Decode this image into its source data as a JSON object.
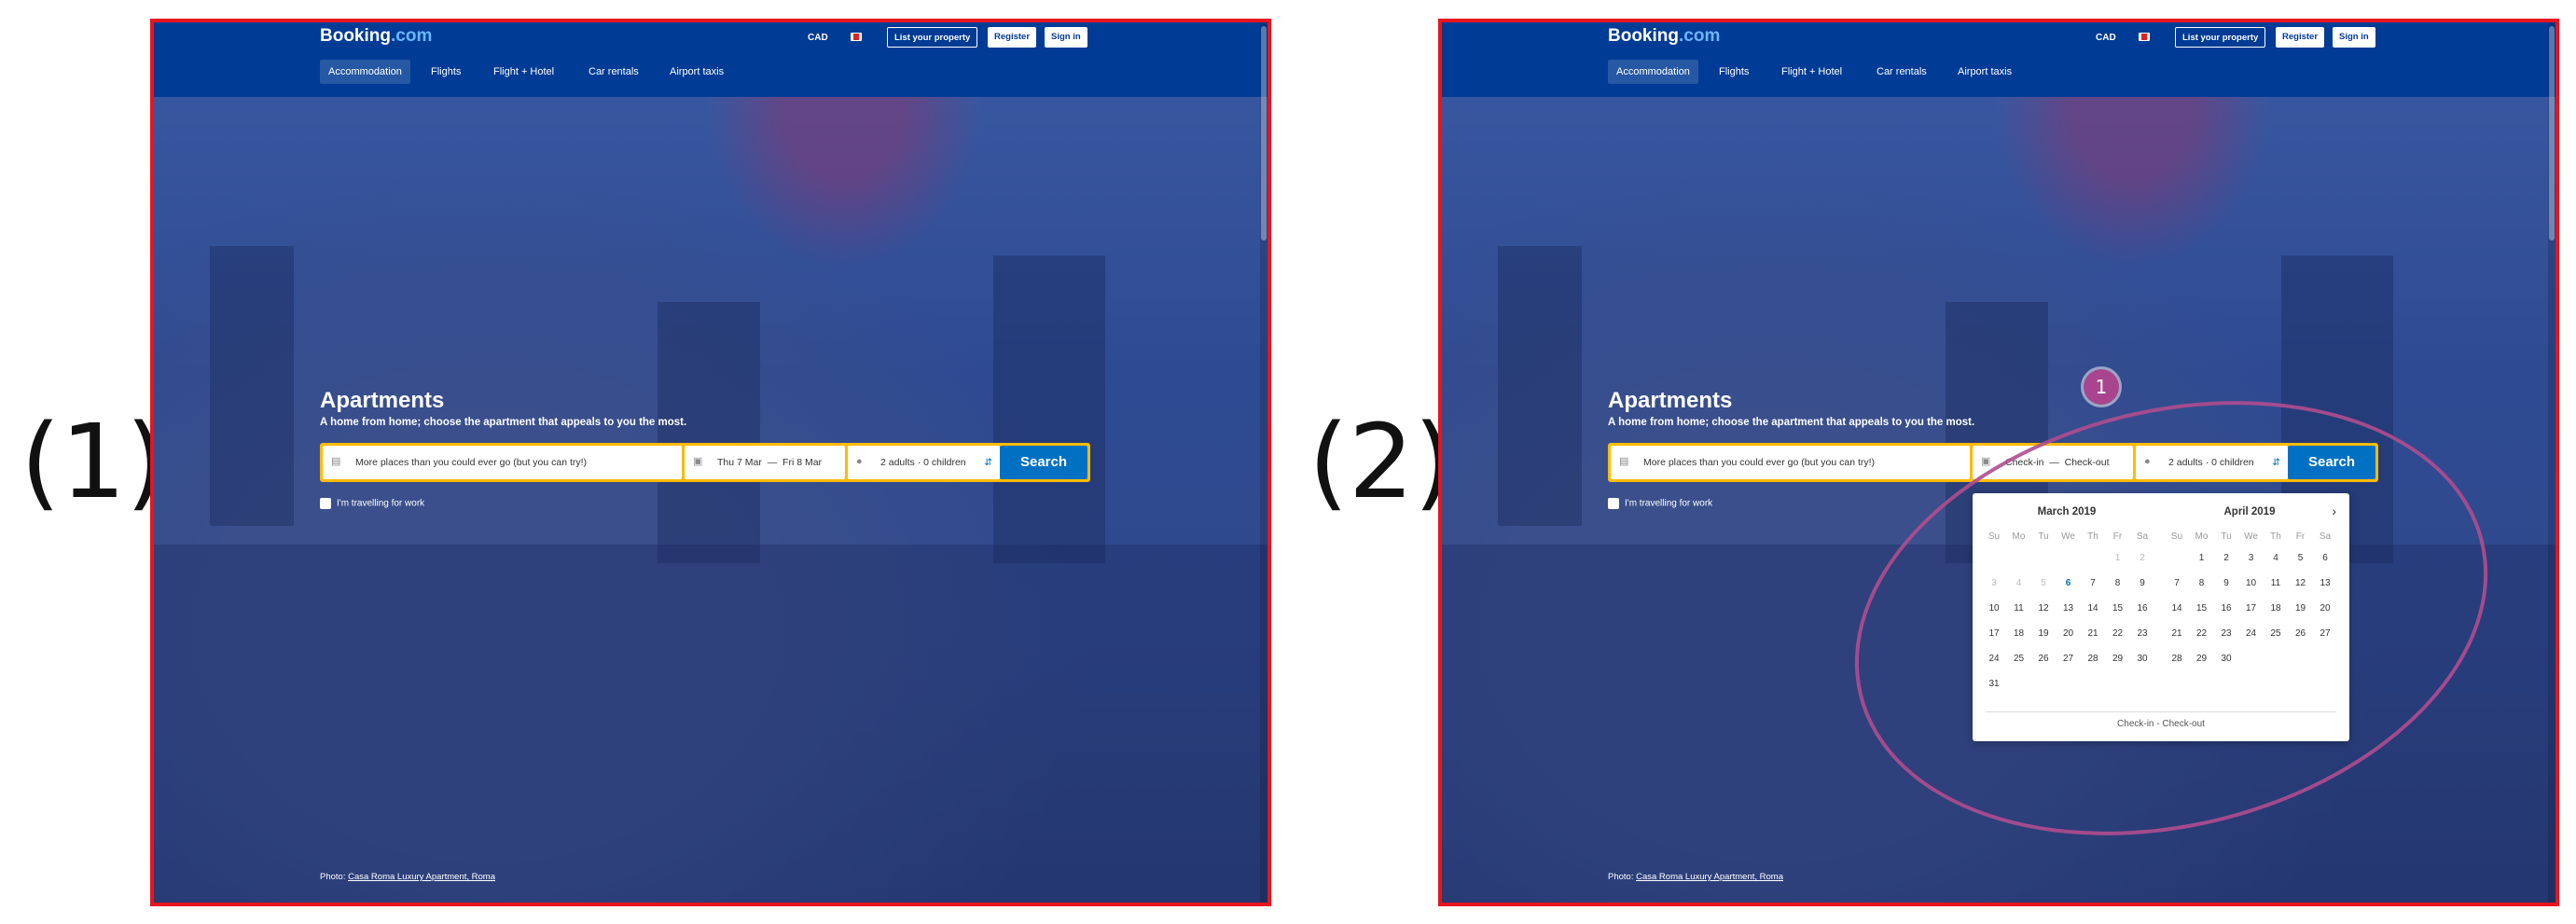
{
  "panels": [
    {
      "label": "(1)",
      "header": {
        "logo_main": "Booking",
        "logo_suffix": ".com",
        "currency": "CAD",
        "list_property": "List your property",
        "register": "Register",
        "sign_in": "Sign in"
      },
      "nav": [
        "Accommodation",
        "Flights",
        "Flight + Hotel",
        "Car rentals",
        "Airport taxis"
      ],
      "title": "Apartments",
      "subtitle": "A home from home; choose the apartment that appeals to you the most.",
      "search": {
        "destination_placeholder": "More places than you could ever go (but you can try!)",
        "checkin": "Thu 7 Mar",
        "dash": "—",
        "checkout": "Fri 8 Mar",
        "guests": "2 adults · 0 children",
        "button": "Search"
      },
      "work_label": "I'm travelling for work",
      "photo_prefix": "Photo: ",
      "photo_link": "Casa Roma Luxury Apartment, Roma"
    },
    {
      "label": "(2)",
      "header": {
        "logo_main": "Booking",
        "logo_suffix": ".com",
        "currency": "CAD",
        "list_property": "List your property",
        "register": "Register",
        "sign_in": "Sign in"
      },
      "nav": [
        "Accommodation",
        "Flights",
        "Flight + Hotel",
        "Car rentals",
        "Airport taxis"
      ],
      "title": "Apartments",
      "subtitle": "A home from home; choose the apartment that appeals to you the most.",
      "search": {
        "destination_placeholder": "More places than you could ever go (but you can try!)",
        "checkin": "Check-in",
        "dash": "—",
        "checkout": "Check-out",
        "guests": "2 adults · 0 children",
        "button": "Search"
      },
      "work_label": "I'm travelling for work",
      "photo_prefix": "Photo: ",
      "photo_link": "Casa Roma Luxury Apartment, Roma",
      "annotation_number": "1",
      "calendar": {
        "weekdays": [
          "Su",
          "Mo",
          "Tu",
          "We",
          "Th",
          "Fr",
          "Sa"
        ],
        "months": [
          {
            "title": "March 2019",
            "weeks": [
              [
                "",
                "",
                "",
                "",
                "",
                "1",
                "2"
              ],
              [
                "3",
                "4",
                "5",
                "6",
                "7",
                "8",
                "9"
              ],
              [
                "10",
                "11",
                "12",
                "13",
                "14",
                "15",
                "16"
              ],
              [
                "17",
                "18",
                "19",
                "20",
                "21",
                "22",
                "23"
              ],
              [
                "24",
                "25",
                "26",
                "27",
                "28",
                "29",
                "30"
              ],
              [
                "31",
                "",
                "",
                "",
                "",
                "",
                ""
              ]
            ],
            "past_days": [
              "1",
              "2",
              "3",
              "4",
              "5"
            ],
            "today": "6"
          },
          {
            "title": "April 2019",
            "weeks": [
              [
                "",
                "1",
                "2",
                "3",
                "4",
                "5",
                "6"
              ],
              [
                "7",
                "8",
                "9",
                "10",
                "11",
                "12",
                "13"
              ],
              [
                "14",
                "15",
                "16",
                "17",
                "18",
                "19",
                "20"
              ],
              [
                "21",
                "22",
                "23",
                "24",
                "25",
                "26",
                "27"
              ],
              [
                "28",
                "29",
                "30",
                "",
                "",
                "",
                ""
              ]
            ]
          }
        ],
        "next_arrow": "›",
        "footer": "Check-in - Check-out"
      }
    }
  ],
  "colors": {
    "header_bg": "#003b95",
    "search_border": "#febb02",
    "search_button": "#0071c2",
    "screenshot_border": "#e8141e",
    "annotation": "#a8458e"
  }
}
